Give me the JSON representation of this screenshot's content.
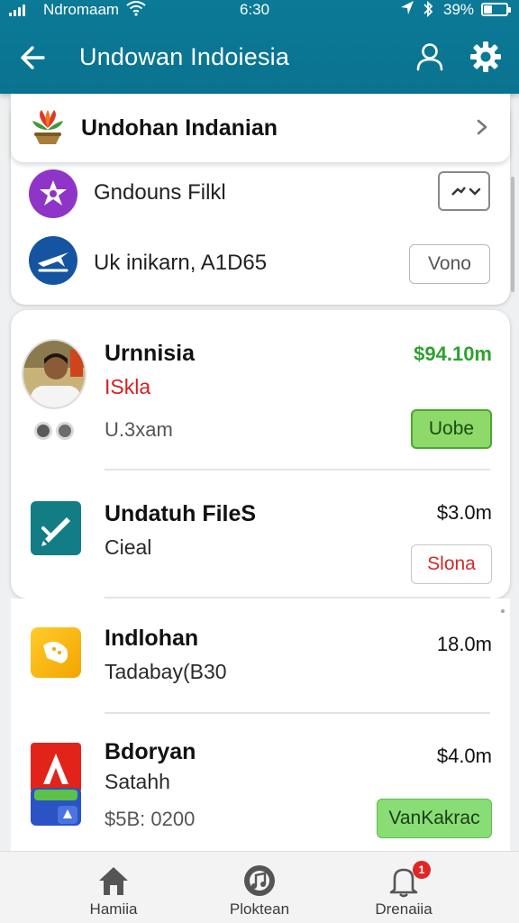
{
  "status_bar": {
    "carrier": "Ndromaam",
    "time": "6:30",
    "battery_percent": "39%",
    "battery_level": 0.39,
    "icons": [
      "signal-icon",
      "wifi-icon",
      "location-icon",
      "bluetooth-icon",
      "battery-icon"
    ]
  },
  "app_bar": {
    "title": "Undowan Indoiesia",
    "icons": [
      "back-arrow-icon",
      "user-icon",
      "gear-icon"
    ],
    "color": "#0b7a96"
  },
  "header_row": {
    "label": "Undohan Indanian",
    "icons": [
      "flower-logo-icon",
      "chevron-right-icon"
    ]
  },
  "settings_rows": [
    {
      "label": "Gndouns Filkl",
      "control": "dropdown",
      "icon": "star-badge-icon",
      "icon_color": "#8e35c8"
    },
    {
      "label": "Uk inikarn, A1D65",
      "control": "button",
      "button_label": "Vono",
      "icon": "plane-icon",
      "icon_color": "#1454a0"
    }
  ],
  "items": [
    {
      "title": "Urnnisia",
      "subtitle": "ISkla",
      "meta": "U.3xam",
      "price": "$94.10m",
      "action": "Uobe",
      "icon": "profile-photo"
    },
    {
      "title": "Undatuh FileS",
      "subtitle": "Cieal",
      "price": "$3.0m",
      "action": "Slona",
      "icon": "pencil-app-icon"
    },
    {
      "title": "Indlohan",
      "subtitle": "Tadabay(B30",
      "price": "18.0m",
      "icon": "chat-app-icon"
    },
    {
      "title": "Bdoryan",
      "subtitle": "Satahh",
      "meta": "$5B: 0200",
      "price": "$4.0m",
      "action": "VanKakrac",
      "icon": "adobe-app-icon"
    }
  ],
  "bottom_nav": [
    {
      "label": "Hamiia",
      "icon": "home-icon"
    },
    {
      "label": "Ploktean",
      "icon": "music-icon"
    },
    {
      "label": "Drenaiia",
      "icon": "bell-icon",
      "badge": "1"
    }
  ],
  "colors": {
    "accent": "#0b7a96",
    "price_positive": "#2ea22e",
    "action_green": "#8fd96a",
    "alert_red": "#d32020"
  }
}
